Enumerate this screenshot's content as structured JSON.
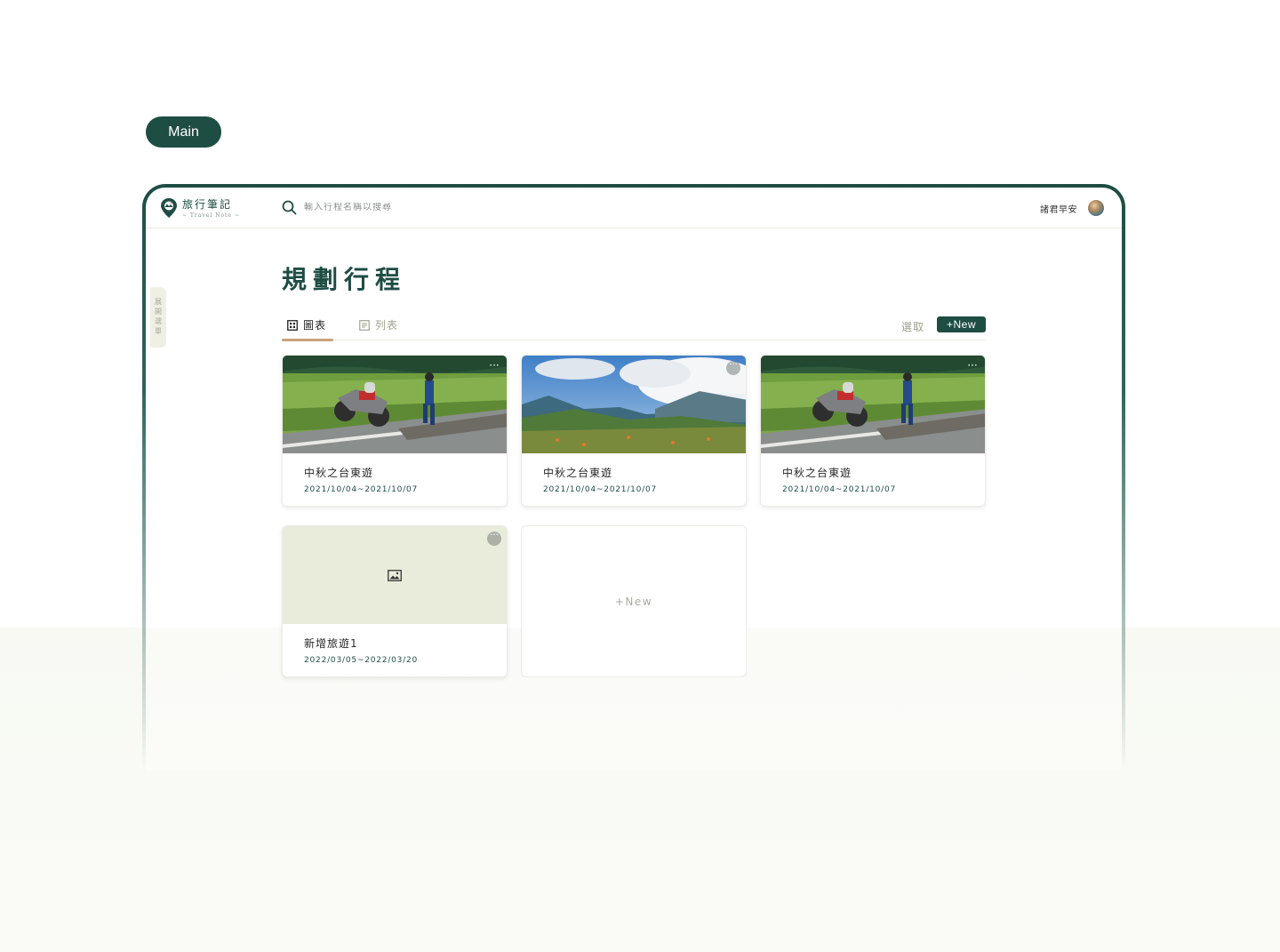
{
  "section_label": "Main",
  "app": {
    "logo_title": "旅行筆記",
    "logo_subtitle": "~ Travel Note ~"
  },
  "search": {
    "placeholder": "輸入行程名稱以搜尋"
  },
  "user": {
    "greeting": "諸君早安"
  },
  "sidebar_toggle": {
    "label": "展開選單"
  },
  "page": {
    "title": "規劃行程"
  },
  "view_tabs": {
    "grid_label": "圖表",
    "list_label": "列表",
    "active": "grid"
  },
  "actions": {
    "select_label": "選取",
    "new_label": "+New"
  },
  "trips": [
    {
      "title": "中秋之台東遊",
      "dates": "2021/10/04~2021/10/07",
      "image": "rice-field-motorcycle"
    },
    {
      "title": "中秋之台東遊",
      "dates": "2021/10/04~2021/10/07",
      "image": "mountain-clouds"
    },
    {
      "title": "中秋之台東遊",
      "dates": "2021/10/04~2021/10/07",
      "image": "rice-field-motorcycle"
    },
    {
      "title": "新增旅遊1",
      "dates": "2022/03/05~2022/03/20",
      "image": "image-placeholder-icon"
    }
  ],
  "new_card_label": "+New",
  "colors": {
    "brand": "#1e4d44",
    "accent_underline": "#c9a27c",
    "placeholder_bg": "#e9ecda"
  }
}
